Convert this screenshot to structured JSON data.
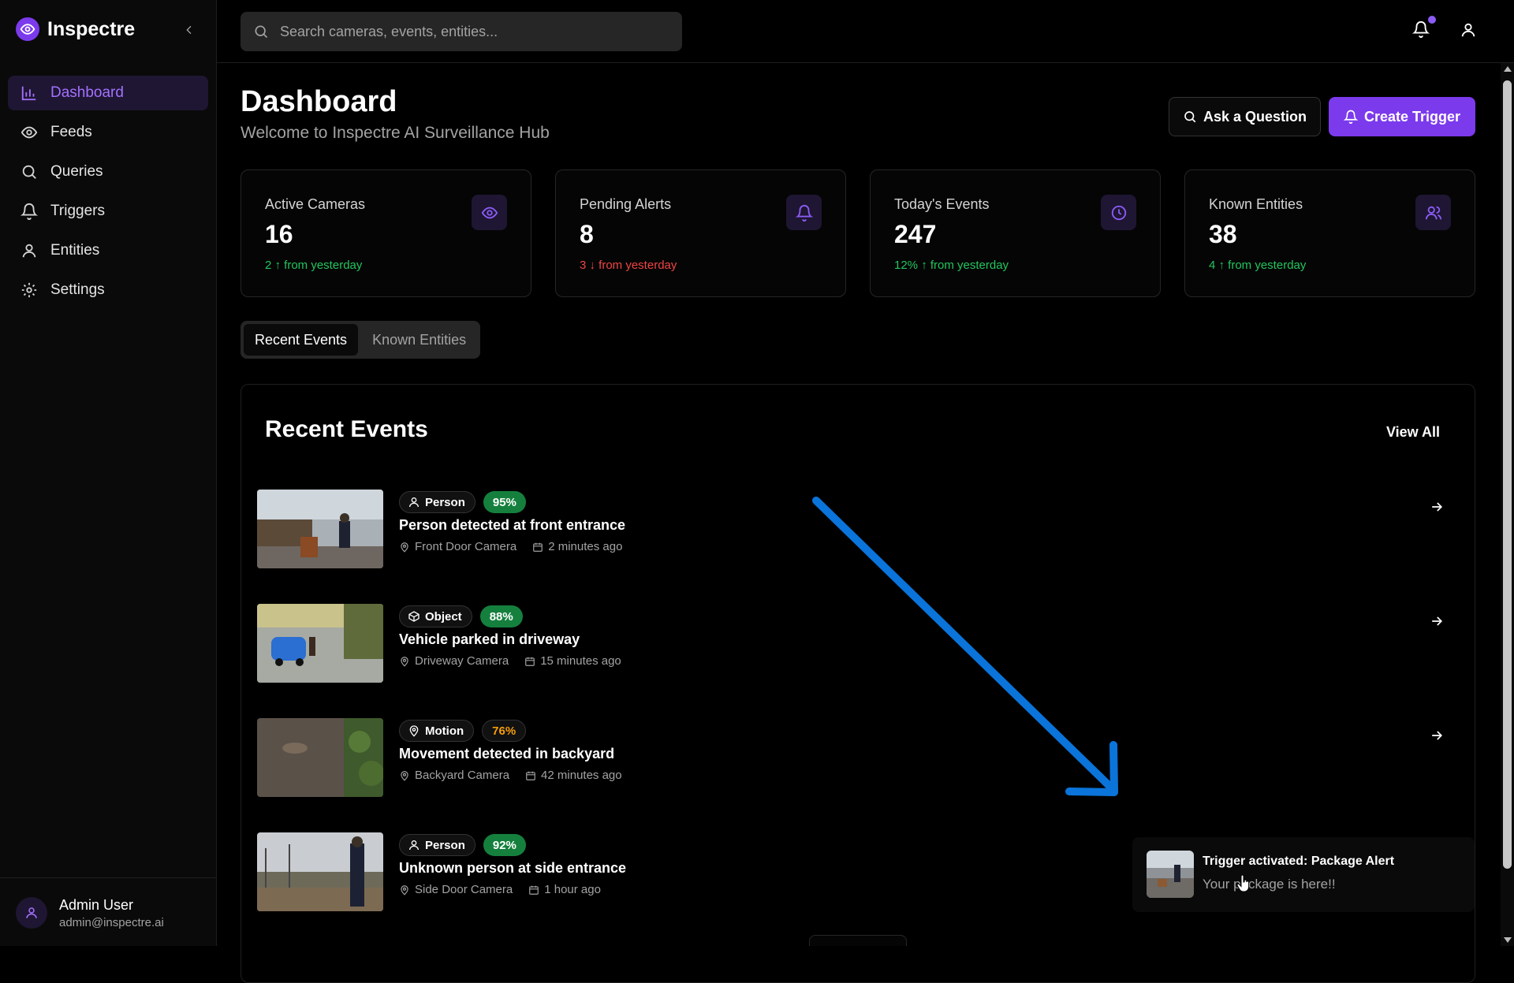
{
  "app": {
    "name": "Inspectre"
  },
  "sidebar": {
    "items": [
      {
        "label": "Dashboard",
        "icon": "bar-chart-icon",
        "active": true
      },
      {
        "label": "Feeds",
        "icon": "eye-icon"
      },
      {
        "label": "Queries",
        "icon": "search-icon"
      },
      {
        "label": "Triggers",
        "icon": "bell-icon"
      },
      {
        "label": "Entities",
        "icon": "user-icon"
      },
      {
        "label": "Settings",
        "icon": "gear-icon"
      }
    ],
    "user": {
      "name": "Admin User",
      "email": "admin@inspectre.ai"
    }
  },
  "search": {
    "placeholder": "Search cameras, events, entities..."
  },
  "header": {
    "title": "Dashboard",
    "subtitle": "Welcome to Inspectre AI Surveillance Hub",
    "ask_label": "Ask a Question",
    "create_label": "Create Trigger"
  },
  "stats": [
    {
      "label": "Active Cameras",
      "value": "16",
      "delta": "2 ↑ from yesterday",
      "trend": "up",
      "icon": "eye-icon"
    },
    {
      "label": "Pending Alerts",
      "value": "8",
      "delta": "3 ↓ from yesterday",
      "trend": "down",
      "icon": "bell-icon"
    },
    {
      "label": "Today's Events",
      "value": "247",
      "delta": "12% ↑ from yesterday",
      "trend": "up",
      "icon": "clock-icon"
    },
    {
      "label": "Known Entities",
      "value": "38",
      "delta": "4 ↑ from yesterday",
      "trend": "up",
      "icon": "users-icon"
    }
  ],
  "tabs": [
    {
      "label": "Recent Events",
      "active": true
    },
    {
      "label": "Known Entities",
      "active": false
    }
  ],
  "events": {
    "title": "Recent Events",
    "view_all": "View All",
    "items": [
      {
        "type": "Person",
        "type_icon": "user-icon",
        "confidence": "95%",
        "title": "Person detected at front entrance",
        "camera": "Front Door Camera",
        "time": "2 minutes ago"
      },
      {
        "type": "Object",
        "type_icon": "box-icon",
        "confidence": "88%",
        "title": "Vehicle parked in driveway",
        "camera": "Driveway Camera",
        "time": "15 minutes ago"
      },
      {
        "type": "Motion",
        "type_icon": "map-pin-icon",
        "confidence": "76%",
        "title": "Movement detected in backyard",
        "camera": "Backyard Camera",
        "time": "42 minutes ago"
      },
      {
        "type": "Person",
        "type_icon": "user-icon",
        "confidence": "92%",
        "title": "Unknown person at side entrance",
        "camera": "Side Door Camera",
        "time": "1 hour ago"
      }
    ]
  },
  "toast": {
    "title": "Trigger activated: Package Alert",
    "message": "Your package is here!!"
  },
  "colors": {
    "accent": "#7c3aed",
    "active_nav_text": "#a371ff",
    "trend_up": "#22c55e",
    "trend_down": "#ef4444",
    "annotation_arrow": "#0a74da"
  }
}
